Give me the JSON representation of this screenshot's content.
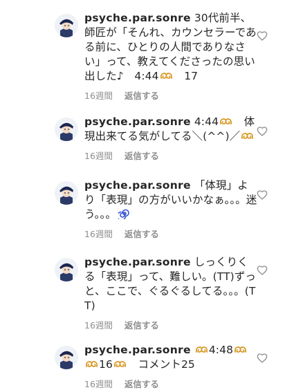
{
  "comments": [
    {
      "username": "psyche.par.sonre",
      "part1": " 30代前半、師匠が「そんれ、カウンセラーである前に、ひとりの人間でありなさい」って、教えてくださったの思い出した♪　4:44",
      "part2": "　17",
      "part3": "",
      "time": "16週間",
      "reply_label": "返信する"
    },
    {
      "username": "psyche.par.sonre",
      "part1": " 4:44",
      "part2": "　体現出来てる気がしてる＼(^^)／",
      "part3": "",
      "time": "16週間",
      "reply_label": "返信する"
    },
    {
      "username": "psyche.par.sonre",
      "part1": " 「体現」より「表現」の方がいいかなぁ。。。迷う。。。",
      "part2": "",
      "part3": "",
      "time": "16週間",
      "reply_label": "返信する"
    },
    {
      "username": "psyche.par.sonre",
      "part1": " しっくりくる「表現」って、難しい。(TT)ずっと、ここで、ぐるぐるしてる。。。(TT)",
      "part2": "",
      "part3": "",
      "time": "16週間",
      "reply_label": "返信する"
    },
    {
      "username": "psyche.par.sonre",
      "part1": " ",
      "part2": "4:48",
      "part3": "16",
      "part4": "　コメント25",
      "time": "16週間",
      "reply_label": "返信する"
    }
  ],
  "icons": {
    "emoji": "pretzel-emoji",
    "emoji2": "cyclone-emoji",
    "like": "heart-outline-icon",
    "avatar": "profile-avatar"
  }
}
